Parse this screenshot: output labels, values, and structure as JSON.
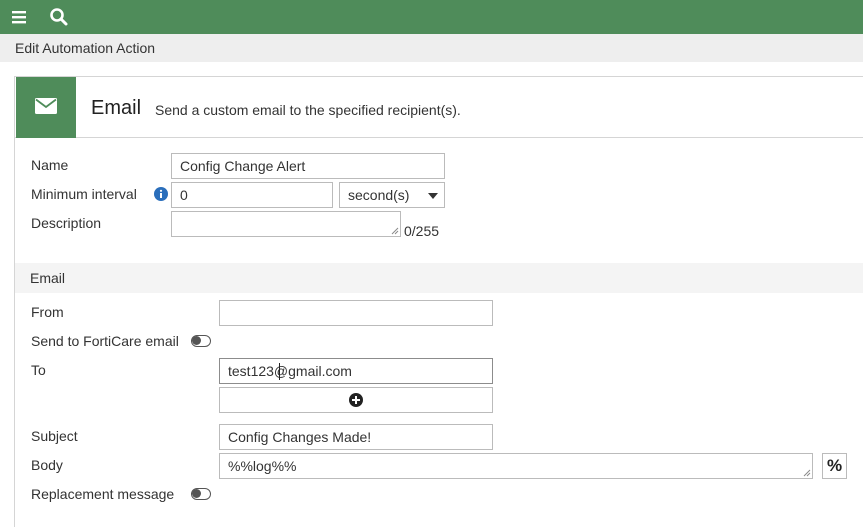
{
  "topbar": {
    "menu_icon": "hamburger-menu-icon",
    "search_icon": "search-icon",
    "bg_color": "#4f8c5a"
  },
  "page": {
    "title": "Edit Automation Action"
  },
  "action": {
    "title": "Email",
    "description": "Send a custom email to the specified recipient(s).",
    "icon": "envelope-icon"
  },
  "form": {
    "name_label": "Name",
    "name_value": "Config Change Alert",
    "min_interval_label": "Minimum interval",
    "min_interval_value": "0",
    "interval_unit": "second(s)",
    "description_label": "Description",
    "description_value": "",
    "description_counter": "0/255"
  },
  "email": {
    "section_title": "Email",
    "from_label": "From",
    "from_value": "",
    "forticare_label": "Send to FortiCare email",
    "forticare_enabled": false,
    "to_label": "To",
    "to_value": "test123@gmail.com",
    "subject_label": "Subject",
    "subject_value": "Config Changes Made!",
    "body_label": "Body",
    "body_value": "%%log%%",
    "percent_button": "%",
    "replacement_label": "Replacement message",
    "replacement_enabled": false
  }
}
